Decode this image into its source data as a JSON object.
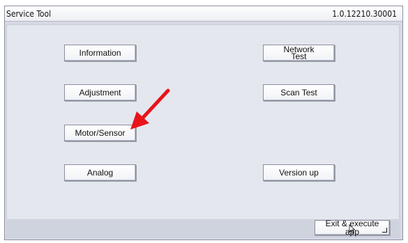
{
  "window": {
    "title": "Service Tool",
    "version": "1.0.12210.30001"
  },
  "menu": {
    "information": "Information",
    "network_test": "Network\nTest",
    "adjustment": "Adjustment",
    "scan_test": "Scan Test",
    "motor_sensor": "Motor/Sensor",
    "analog": "Analog",
    "version_up": "Version up"
  },
  "footer": {
    "exit_label": "Exit & execute app"
  },
  "icons": {
    "enter": "enter-icon",
    "cursor": "mouse-cursor-icon",
    "annotation_arrow": "red-arrow-annotation"
  },
  "colors": {
    "annotation": "#e8141a",
    "panel_bg": "#e5e7ef",
    "frame_bg": "#d6d9e4"
  }
}
